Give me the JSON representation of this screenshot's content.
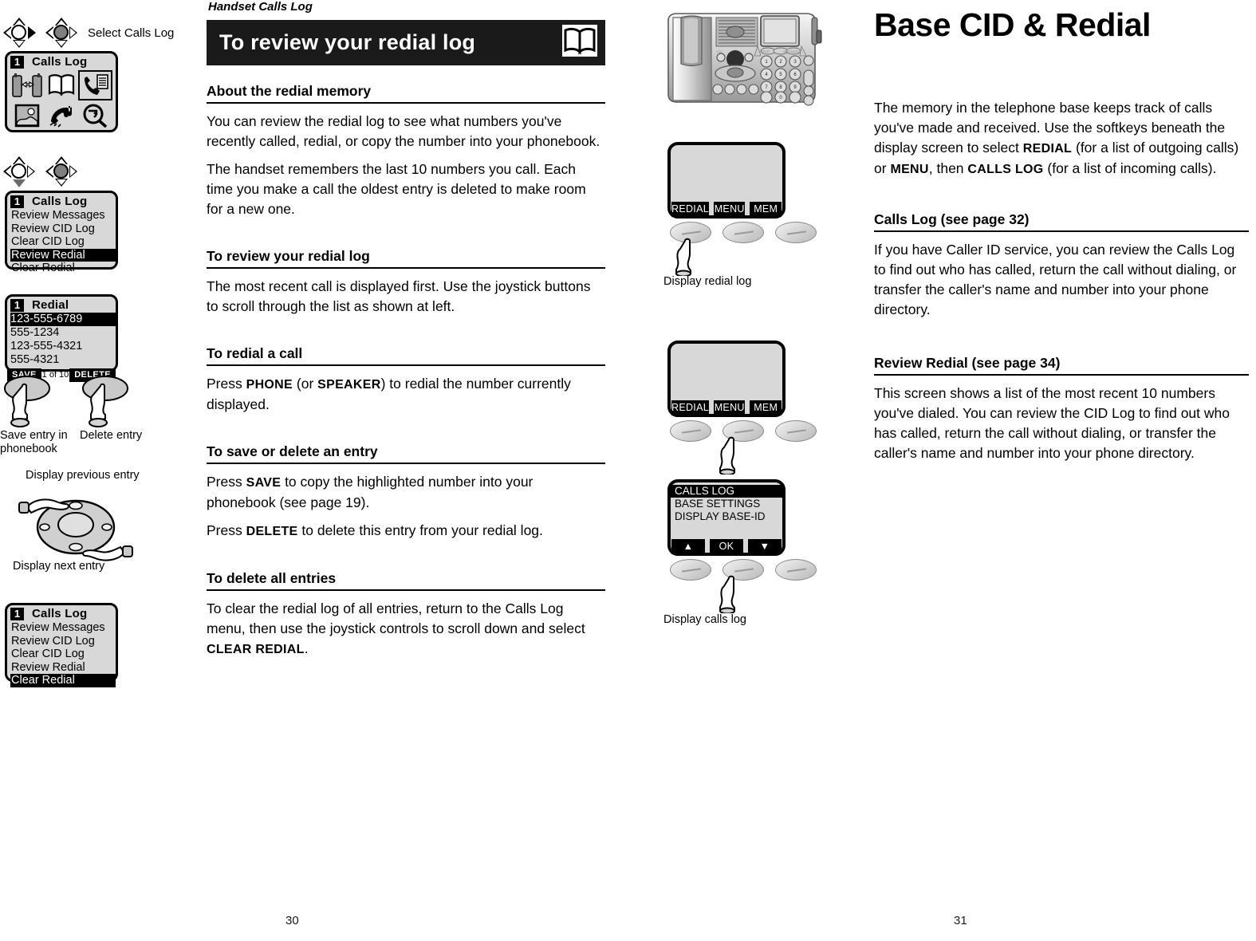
{
  "left_margin": {
    "nav1": {
      "caption": "Select Calls Log"
    },
    "calls_log_icon_screen": {
      "badge": "1",
      "title": "Calls Log",
      "icons": [
        "intercom-handsets-icon",
        "phonebook-book-icon",
        "calls-log-icon",
        "display-picture-icon",
        "ringer-melody-icon",
        "search-icon"
      ],
      "selected_icon": "calls-log-icon"
    },
    "calls_log_menu_screen": {
      "badge": "1",
      "title": "Calls Log",
      "items": [
        "Review Messages",
        "Review CID Log",
        "Clear CID Log",
        "Review Redial",
        "Clear Redial"
      ],
      "selected": "Review Redial"
    },
    "redial_screen": {
      "badge": "1",
      "title": "Redial",
      "entries": [
        "123-555-6789",
        "555-1234",
        "123-555-4321",
        "555-4321"
      ],
      "selected": "123-555-6789",
      "softkey_left": "SAVE",
      "counter": "1 of 10",
      "softkey_right": "DELETE"
    },
    "hand_captions": {
      "save": "Save entry in\nphonebook",
      "save_line1": "Save entry in",
      "save_line2": "phonebook",
      "delete": "Delete entry",
      "prev": "Display previous entry",
      "next": "Display next entry"
    },
    "clear_redial_screen": {
      "badge": "1",
      "title": "Calls Log",
      "items": [
        "Review Messages",
        "Review CID Log",
        "Clear CID Log",
        "Review Redial",
        "Clear Redial"
      ],
      "selected": "Clear Redial"
    }
  },
  "page30": {
    "running_head": "Handset Calls Log",
    "banner_title": "To review your redial log",
    "banner_icon": "open-book-icon",
    "sections": [
      {
        "heading": "About the redial memory",
        "paragraphs": [
          "You can review the redial log to see what numbers you've recently called, redial, or copy the number into your phonebook.",
          "The handset remembers the last 10 numbers you call. Each time you make a call the oldest entry is deleted to make room for a new one."
        ]
      },
      {
        "heading": "To review your redial log",
        "paragraphs": [
          "The most recent call is displayed first. Use the joystick buttons to scroll through the list as shown at left."
        ]
      },
      {
        "heading": "To redial a call",
        "paragraphs": []
      },
      {
        "heading": "To save or delete an entry",
        "paragraphs": []
      },
      {
        "heading": "To delete all entries",
        "paragraphs": []
      }
    ],
    "redial_call_p": {
      "a": "Press ",
      "b": "PHONE",
      "c": " (or ",
      "d": "SPEAKER",
      "e": ") to redial the number currently displayed."
    },
    "save_p": {
      "a": "Press ",
      "b": "SAVE",
      "c": " to copy the highlighted number into your phonebook (see page 19)."
    },
    "delete_p": {
      "a": "Press ",
      "b": "DELETE",
      "c": " to delete this entry from your redial log."
    },
    "delete_all_p": {
      "a": "To clear the redial log of all entries, return to the Calls Log menu, then use the joystick controls to scroll down and select ",
      "b": "CLEAR REDIAL",
      "c": "."
    },
    "page_number": "30"
  },
  "base_graphics": {
    "telephone_base_image": "telephone-base-illustration",
    "screen1": {
      "softkeys": [
        "REDIAL",
        "MENU",
        "MEM"
      ],
      "caption": "Display redial log",
      "pressed": "REDIAL"
    },
    "screen2": {
      "softkeys": [
        "REDIAL",
        "MENU",
        "MEM"
      ],
      "pressed": "MENU"
    },
    "screen3": {
      "items": [
        "CALLS LOG",
        "BASE SETTINGS",
        "DISPLAY BASE-ID"
      ],
      "selected": "CALLS LOG",
      "softkeys": [
        "▲",
        "OK",
        "▼"
      ],
      "pressed": "OK",
      "caption": "Display calls log"
    }
  },
  "page31": {
    "chapter_title": "Base CID & Redial",
    "intro": {
      "a": "The memory in the telephone base keeps track of calls you've made and received. Use the softkeys beneath the display screen to select ",
      "b": "REDIAL",
      "c": " (for a list of outgoing calls) or ",
      "d": "MENU",
      "e": ", then ",
      "f": "CALLS LOG",
      "g": " (for a list of incoming calls)."
    },
    "sections": [
      {
        "heading": "Calls Log (see page 32)",
        "paragraph": "If you have Caller ID service, you can review the Calls Log to find out who has called, return the call without dialing, or transfer the caller's name and number into your phone directory."
      },
      {
        "heading": "Review Redial (see page 34)",
        "paragraph": "This screen shows a list of the most recent 10 numbers you've dialed. You can review the CID Log to find out who has called, return the call without dialing, or transfer the caller's name and number into your phone directory."
      }
    ],
    "page_number": "31"
  }
}
